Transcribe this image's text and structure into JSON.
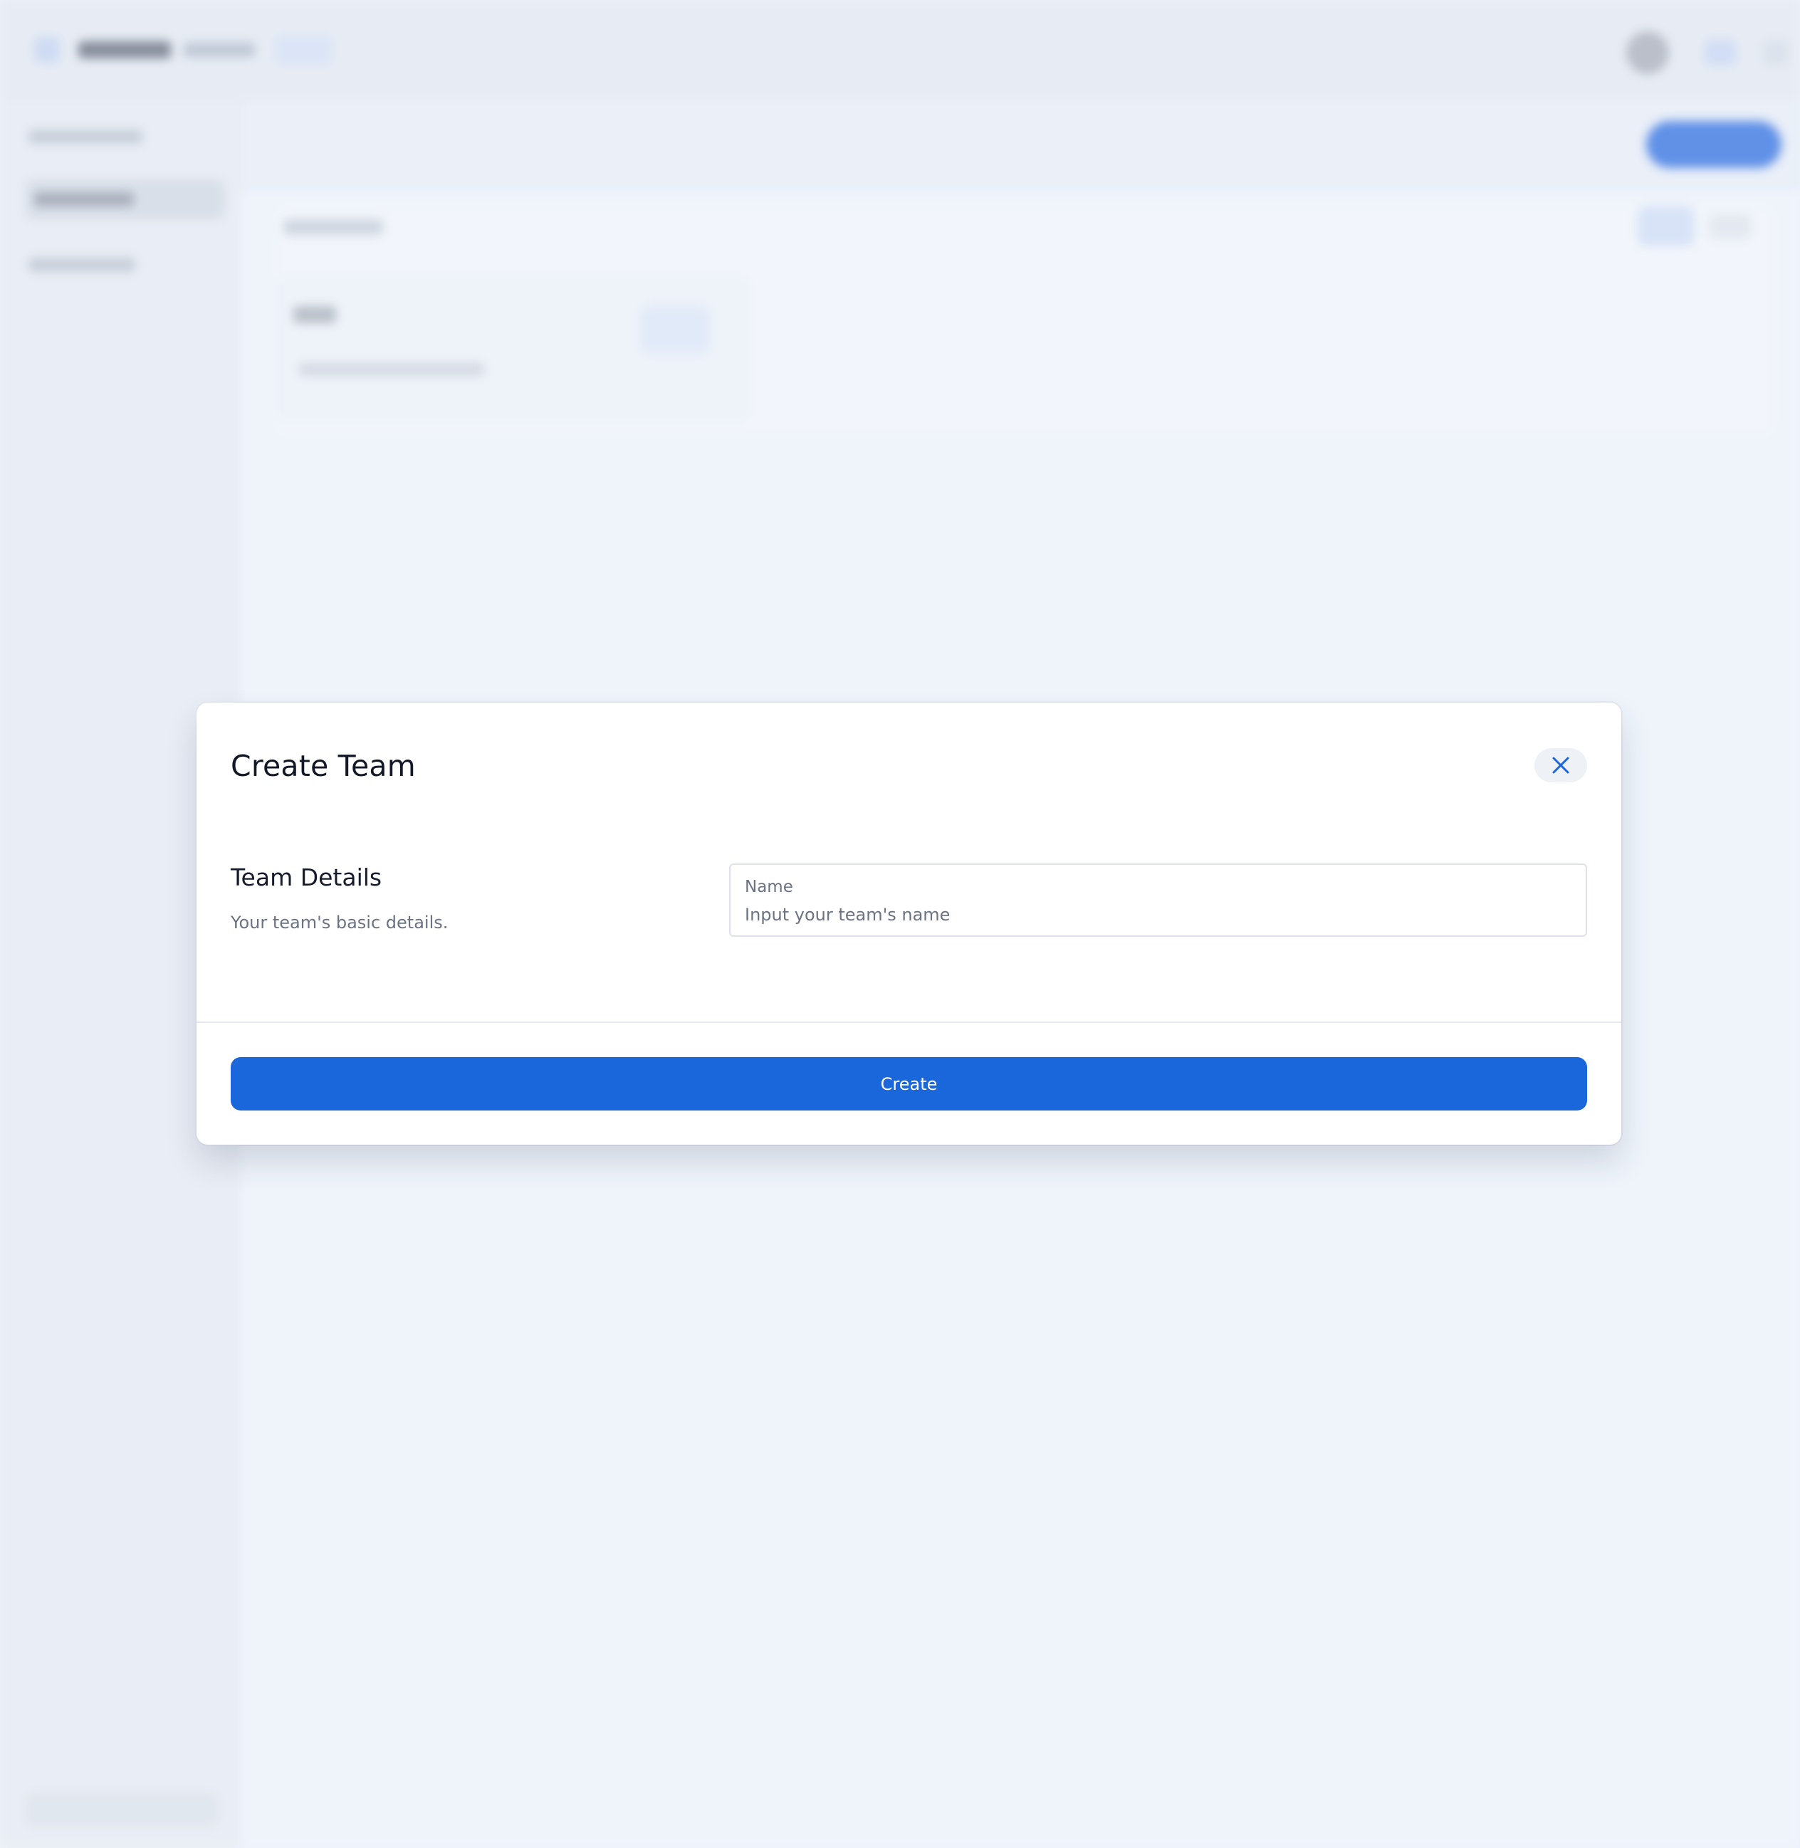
{
  "modal": {
    "title": "Create Team",
    "section": {
      "title": "Team Details",
      "description": "Your team's basic details."
    },
    "name_field": {
      "label": "Name",
      "value": "",
      "placeholder": "Input your team's name"
    },
    "primary_action": "Create",
    "close_icon": "close-icon"
  },
  "colors": {
    "accent": "#1a66db",
    "page_background": "#eef2fa",
    "modal_background": "#ffffff",
    "title_text": "#121826",
    "muted_text": "#6b7383"
  }
}
